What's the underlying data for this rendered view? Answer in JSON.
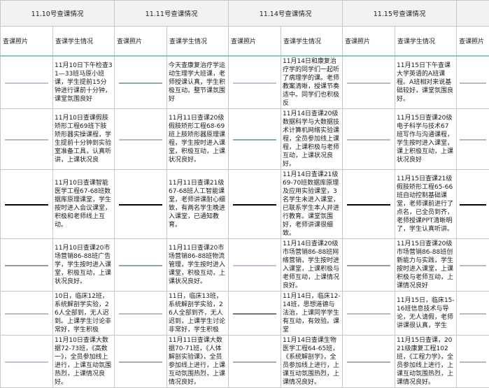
{
  "headers": [
    "11.10号查课情况",
    "11.11号查课情况",
    "11.14号查课情况",
    "11.15号查课情况"
  ],
  "subheaders": {
    "photo": "查课照片",
    "status": "查课学生情况"
  },
  "rows": [
    {
      "c1": "11月10日下午检查31—33班马原小班课，学生提前15分钟进行课前十分钟，课堂氛围良好",
      "c2": "今天查康复治疗学运动生理学大班课，老师授课认真，学生积极互动。整节课氛围好",
      "c3": "11月14日和康复治疗学的同学们一起听了病理学的课。老师教案清晰，授课节奏适中。同学们也积极反",
      "c4": "11月15日下午查课大学英语的A班课程。A班相对来说基础较好，课堂氛围良好。",
      "p1": "t-doc",
      "p2": "t-screen",
      "p3": "t-doc",
      "p4": "t-class"
    },
    {
      "c1": "11月10日查课假肢矫形工程69班下肢矫形器实操课程，学生提前十分钟到实验室准备工具，认真听讲，上课状况良",
      "c2": "11月11日查课20级假肢矫形工程68-69班上肢矫形器原理课程，学生按时进入课堂，积极互动，上课状况良好。",
      "c3": "11月14日查课20级数据科学与大数据技术计算机网络实验课程，全员参加线上课程，上课积极与老师互动，上课状况良好。",
      "c4": "11月15日查课20级电子科学与技术67班写作与沟通课程，学生按时进入课堂，课上积极互动，上课状况良好",
      "p1": "t-people",
      "p2": "t-class",
      "p3": "t-screen",
      "p4": "t-class"
    },
    {
      "c1": "11月10日查课智能医学工程67-68班数据库原理课堂，学生按时进入会议课堂，积极和老师线上互动。",
      "c2": "11月11日查课21级67-68班人工智能课堂，老师讲课耐心细致，有两名学生晚进入课堂，已通知教育。",
      "c3": "11月14日查课21级69-70班数据库原理及应用实验课堂，3名学生未进入课堂，已联系学生本人并进行教育。课堂氛围好，老师讲课很细致。",
      "c4": "11月15日查课21级假肢矫形工程65-66班自动控制基础课堂，老师课前进行了点名，已全员到齐，老师授课PPT清晰明了，学生认真听讲。",
      "p1": "t-dark",
      "p2": "t-dark",
      "p3": "t-dark",
      "p4": "t-dark"
    },
    {
      "c1": "11月10日查课20市场营销86-88班广告学，学生按时进入课堂，积极互动，上课状况良好。",
      "c2": "11月11日查课20市场营销86-88班物流管理，学生按时进入课堂，积极互动，上课状况良好。",
      "c3": "11月14日查课20级市场营销86-88班网络营销，学生按时进入课堂，上课积极与老师互动，上课情况良好。",
      "c4": "11月15日查课20级市场营销86-88班创新能力与实践，学生按时进入课堂，上课积极与老师互动，上课情况良好",
      "p1": "t-chart",
      "p2": "t-screen",
      "p3": "t-doc",
      "p4": "t-chart"
    },
    {
      "c1": "10日，临床12班，系统解剖学实验，26人全部到，无人迟到。上课学生讨论非常好，学生积极",
      "c2": "11日，临床13班，系统解剖学实验，26人全部到齐，无人迟到，上课学生讨论非常好，学生积极",
      "c3": "11月14日，临床12-14班，思想道德与法治，上课同学学生有互动，有效验。课堂",
      "c4": "11月15日，临床15-16班信息技术与导论，无人请假，老师讲课很认真，学生",
      "p1": "t-people",
      "p2": "t-people",
      "p3": "t-green",
      "p4": "t-class"
    },
    {
      "c1": "11月10日查课大数据72-73班，《高数一》，全员参加线上进行，上课互动氛围热烈，上课情况良好。",
      "c2": "11月11日查课大数据70-71班，《人体解剖实验课》，全员参加线上进行，上课互动氛围热烈，上课情况良好。",
      "c3": "11月14日查课生物医学工程64-65班，《系统解剖学》，全员参加线上进行，上课互动氛围热烈，上课情况良好。",
      "c4": "11月15日查课，2021级康复工程102班，《工程力学》，全员参加线上进行，上课互动氛围热烈，上课情况良好。",
      "p1": "t-doc",
      "p2": "t-pink",
      "p3": "t-pink",
      "p4": "t-pink"
    }
  ]
}
